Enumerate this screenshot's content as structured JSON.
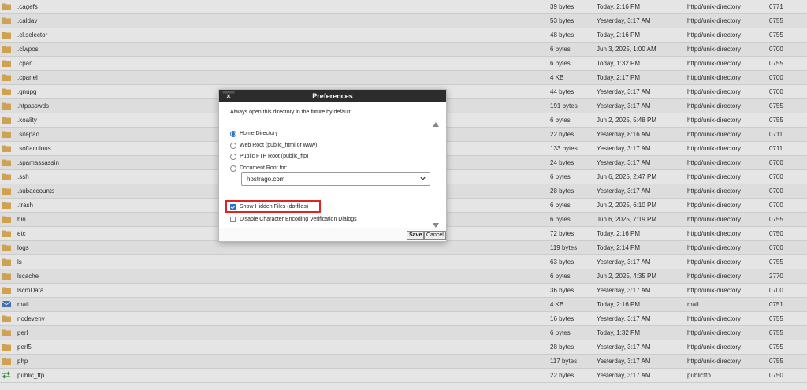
{
  "files": [
    {
      "name": ".cagefs",
      "size": "39 bytes",
      "modified": "Today, 2:16 PM",
      "type": "httpd/unix-directory",
      "perms": "0771",
      "icon": "folder-icon"
    },
    {
      "name": ".caldav",
      "size": "53 bytes",
      "modified": "Yesterday, 3:17 AM",
      "type": "httpd/unix-directory",
      "perms": "0755",
      "icon": "folder-icon"
    },
    {
      "name": ".cl.selector",
      "size": "48 bytes",
      "modified": "Today, 2:16 PM",
      "type": "httpd/unix-directory",
      "perms": "0755",
      "icon": "folder-icon"
    },
    {
      "name": ".clwpos",
      "size": "6 bytes",
      "modified": "Jun 3, 2025, 1:00 AM",
      "type": "httpd/unix-directory",
      "perms": "0700",
      "icon": "folder-icon"
    },
    {
      "name": ".cpan",
      "size": "6 bytes",
      "modified": "Today, 1:32 PM",
      "type": "httpd/unix-directory",
      "perms": "0755",
      "icon": "folder-icon"
    },
    {
      "name": ".cpanel",
      "size": "4 KB",
      "modified": "Today, 2:17 PM",
      "type": "httpd/unix-directory",
      "perms": "0700",
      "icon": "folder-icon"
    },
    {
      "name": ".gnupg",
      "size": "44 bytes",
      "modified": "Yesterday, 3:17 AM",
      "type": "httpd/unix-directory",
      "perms": "0700",
      "icon": "folder-icon"
    },
    {
      "name": ".htpasswds",
      "size": "191 bytes",
      "modified": "Yesterday, 3:17 AM",
      "type": "httpd/unix-directory",
      "perms": "0755",
      "icon": "folder-icon"
    },
    {
      "name": ".koality",
      "size": "6 bytes",
      "modified": "Jun 2, 2025, 5:48 PM",
      "type": "httpd/unix-directory",
      "perms": "0755",
      "icon": "folder-icon"
    },
    {
      "name": ".sitepad",
      "size": "22 bytes",
      "modified": "Yesterday, 8:16 AM",
      "type": "httpd/unix-directory",
      "perms": "0711",
      "icon": "folder-icon"
    },
    {
      "name": ".softaculous",
      "size": "133 bytes",
      "modified": "Yesterday, 3:17 AM",
      "type": "httpd/unix-directory",
      "perms": "0711",
      "icon": "folder-icon"
    },
    {
      "name": ".spamassassin",
      "size": "24 bytes",
      "modified": "Yesterday, 3:17 AM",
      "type": "httpd/unix-directory",
      "perms": "0700",
      "icon": "folder-icon"
    },
    {
      "name": ".ssh",
      "size": "6 bytes",
      "modified": "Jun 6, 2025, 2:47 PM",
      "type": "httpd/unix-directory",
      "perms": "0700",
      "icon": "folder-icon"
    },
    {
      "name": ".subaccounts",
      "size": "28 bytes",
      "modified": "Yesterday, 3:17 AM",
      "type": "httpd/unix-directory",
      "perms": "0700",
      "icon": "folder-icon"
    },
    {
      "name": ".trash",
      "size": "6 bytes",
      "modified": "Jun 2, 2025, 6:10 PM",
      "type": "httpd/unix-directory",
      "perms": "0700",
      "icon": "folder-icon"
    },
    {
      "name": "bin",
      "size": "6 bytes",
      "modified": "Jun 6, 2025, 7:19 PM",
      "type": "httpd/unix-directory",
      "perms": "0755",
      "icon": "folder-icon"
    },
    {
      "name": "etc",
      "size": "72 bytes",
      "modified": "Today, 2:16 PM",
      "type": "httpd/unix-directory",
      "perms": "0750",
      "icon": "folder-icon"
    },
    {
      "name": "logs",
      "size": "119 bytes",
      "modified": "Today, 2:14 PM",
      "type": "httpd/unix-directory",
      "perms": "0700",
      "icon": "folder-icon"
    },
    {
      "name": "ls",
      "size": "63 bytes",
      "modified": "Yesterday, 3:17 AM",
      "type": "httpd/unix-directory",
      "perms": "0755",
      "icon": "folder-icon"
    },
    {
      "name": "lscache",
      "size": "6 bytes",
      "modified": "Jun 2, 2025, 4:35 PM",
      "type": "httpd/unix-directory",
      "perms": "2770",
      "icon": "folder-icon"
    },
    {
      "name": "lscmData",
      "size": "36 bytes",
      "modified": "Yesterday, 3:17 AM",
      "type": "httpd/unix-directory",
      "perms": "0700",
      "icon": "folder-icon"
    },
    {
      "name": "mail",
      "size": "4 KB",
      "modified": "Today, 2:16 PM",
      "type": "mail",
      "perms": "0751",
      "icon": "mail-icon"
    },
    {
      "name": "nodevenv",
      "size": "16 bytes",
      "modified": "Yesterday, 3:17 AM",
      "type": "httpd/unix-directory",
      "perms": "0755",
      "icon": "folder-icon"
    },
    {
      "name": "perl",
      "size": "6 bytes",
      "modified": "Today, 1:32 PM",
      "type": "httpd/unix-directory",
      "perms": "0755",
      "icon": "folder-icon"
    },
    {
      "name": "perl5",
      "size": "28 bytes",
      "modified": "Yesterday, 3:17 AM",
      "type": "httpd/unix-directory",
      "perms": "0755",
      "icon": "folder-icon"
    },
    {
      "name": "php",
      "size": "117 bytes",
      "modified": "Yesterday, 3:17 AM",
      "type": "httpd/unix-directory",
      "perms": "0755",
      "icon": "folder-icon"
    },
    {
      "name": "public_ftp",
      "size": "22 bytes",
      "modified": "Yesterday, 3:17 AM",
      "type": "publicftp",
      "perms": "0750",
      "icon": "public-ftp-icon"
    }
  ],
  "dialog": {
    "title": "Preferences",
    "intro": "Always open this directory in the future by default:",
    "options": [
      {
        "label": "Home Directory",
        "selected": true
      },
      {
        "label": "Web Root (public_html or www)",
        "selected": false
      },
      {
        "label": "Public FTP Root (public_ftp)",
        "selected": false
      },
      {
        "label": "Document Root for:",
        "selected": false
      }
    ],
    "domain_value": "hostrago.com",
    "show_hidden_label": "Show Hidden Files (dotfiles)",
    "show_hidden_checked": true,
    "disable_encoding_label": "Disable Character Encoding Verification Dialogs",
    "disable_encoding_checked": false,
    "save_label": "Save",
    "cancel_label": "Cancel"
  },
  "colors": {
    "folder": "#e8b55a",
    "mail": "#4a7fc1",
    "ftp": "#3a9a4a",
    "highlight": "#e02424",
    "accent": "#2a6fd6"
  }
}
